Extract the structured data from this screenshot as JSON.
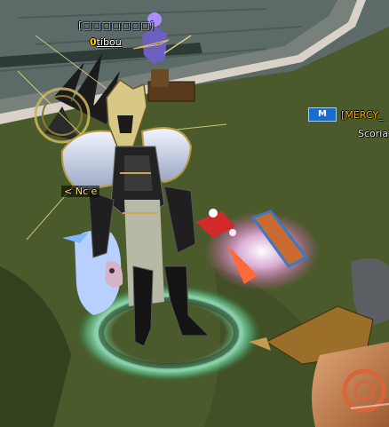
{
  "scene": {
    "type": "3d-mmo-game-view",
    "colors": {
      "grass": "#4b5a2c",
      "dark_grass": "#2f3a1b",
      "road": "#6b7569",
      "road_edge": "#d8d2ca",
      "plaza": "#5b6a6d"
    }
  },
  "labels": {
    "guild_tag": "[□□□□□□□]",
    "player_number": "0",
    "player_name": "tibou",
    "mercy_guild": "[MERCY_",
    "scoria_name": "Scoria",
    "hero_name": "< Nc           e"
  },
  "icons": {
    "guild_emblem": "guild-emblem-icon"
  }
}
